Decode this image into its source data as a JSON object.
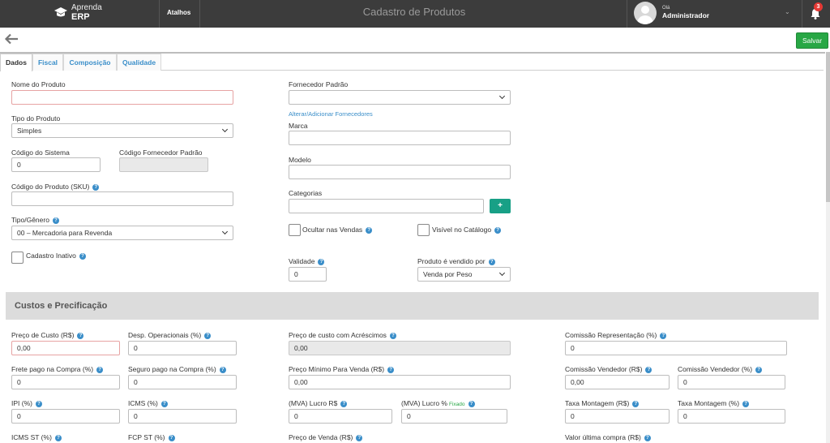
{
  "header": {
    "logo_line1": "Aprenda",
    "logo_line2": "ERP",
    "shortcuts": "Atalhos",
    "title": "Cadastro de Produtos",
    "greeting": "Olá",
    "user": "Administrador",
    "notifications": "3"
  },
  "toolbar": {
    "save": "Salvar"
  },
  "tabs": [
    "Dados",
    "Fiscal",
    "Composição",
    "Qualidade"
  ],
  "form": {
    "nome_label": "Nome do Produto",
    "nome_value": "",
    "tipo_label": "Tipo do Produto",
    "tipo_value": "Simples",
    "codsis_label": "Código do Sistema",
    "codsis_value": "0",
    "codforn_label": "Código Fornecedor Padrão",
    "codforn_value": "",
    "sku_label": "Código do Produto (SKU)",
    "sku_value": "",
    "tipogen_label": "Tipo/Gênero",
    "tipogen_value": "00 – Mercadoria para Revenda",
    "inativo_label": "Cadastro Inativo",
    "fornecedor_label": "Fornecedor Padrão",
    "fornecedor_value": "",
    "fornecedor_link": "Alterar/Adicionar Fornecedores",
    "marca_label": "Marca",
    "modelo_label": "Modelo",
    "categorias_label": "Categorias",
    "categorias_add": "+",
    "ocultar_label": "Ocultar nas Vendas",
    "visivel_label": "Visível no Catálogo",
    "validade_label": "Validade",
    "validade_value": "0",
    "vendido_label": "Produto é vendido por",
    "vendido_value": "Venda por Peso"
  },
  "costs": {
    "section_title": "Custos e Precificação",
    "preco_custo_label": "Preço de Custo (R$)",
    "preco_custo_value": "0,00",
    "desp_label": "Desp. Operacionais (%)",
    "desp_value": "0",
    "custo_acresc_label": "Preço de custo com Acréscimos",
    "custo_acresc_value": "0,00",
    "com_rep_label": "Comissão Representação (%)",
    "com_rep_value": "0",
    "frete_label": "Frete pago na Compra (%)",
    "frete_value": "0",
    "seguro_label": "Seguro pago na Compra (%)",
    "seguro_value": "0",
    "preco_min_label": "Preço Mínimo Para Venda (R$)",
    "preco_min_value": "0,00",
    "com_vend_rs_label": "Comissão Vendedor (R$)",
    "com_vend_rs_value": "0,00",
    "com_vend_pct_label": "Comissão Vendedor (%)",
    "com_vend_pct_value": "0",
    "ipi_label": "IPI (%)",
    "ipi_value": "0",
    "icms_label": "ICMS (%)",
    "icms_value": "0",
    "mva_rs_label": "(MVA) Lucro R$",
    "mva_rs_value": "0",
    "mva_pct_label": "(MVA) Lucro %",
    "mva_fixed": "Fixado",
    "mva_pct_value": "0",
    "tm_rs_label": "Taxa Montagem (R$)",
    "tm_rs_value": "0",
    "tm_pct_label": "Taxa Montagem (%)",
    "tm_pct_value": "0",
    "icmsst_label": "ICMS ST (%)",
    "fcpst_label": "FCP ST (%)",
    "preco_venda_label": "Preço de Venda (R$)",
    "ultima_compra_label": "Valor última compra (R$)"
  },
  "colors": {
    "accent": "#3a8ec9",
    "save": "#28a745",
    "add": "#18a086",
    "topbar": "#3c3c3c"
  }
}
